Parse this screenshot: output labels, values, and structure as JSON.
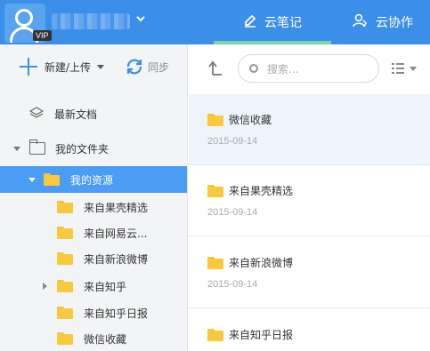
{
  "header": {
    "vip_badge": "VIP",
    "tabs": [
      {
        "label": "云笔记",
        "active": true,
        "icon": "pencil-icon"
      },
      {
        "label": "云协作",
        "active": false,
        "icon": "user-icon"
      }
    ]
  },
  "sidebar": {
    "new_label": "新建/上传",
    "sync_label": "同步",
    "recent_label": "最新文档",
    "my_folder_label": "我的文件夹",
    "my_resources_label": "我的资源",
    "subfolders": [
      {
        "label": "来自果壳精选",
        "has_children": false
      },
      {
        "label": "来自网易云...",
        "has_children": false
      },
      {
        "label": "来自新浪微博",
        "has_children": false
      },
      {
        "label": "来自知乎",
        "has_children": true
      },
      {
        "label": "来自知乎日报",
        "has_children": false
      },
      {
        "label": "微信收藏",
        "has_children": false
      }
    ]
  },
  "list": {
    "search_placeholder": "搜索...",
    "items": [
      {
        "title": "微信收藏",
        "date": "2015-09-14",
        "selected": true
      },
      {
        "title": "来自果壳精选",
        "date": "2015-09-14",
        "selected": false
      },
      {
        "title": "来自新浪微博",
        "date": "2015-09-14",
        "selected": false
      },
      {
        "title": "来自知乎日报",
        "date": "",
        "selected": false
      }
    ]
  },
  "colors": {
    "header_bg": "#3b8fe8",
    "active_tab_underline": "#7fd3a8",
    "selected_folder_bg": "#4a9cf5",
    "folder_yellow": "#f8c93c"
  }
}
